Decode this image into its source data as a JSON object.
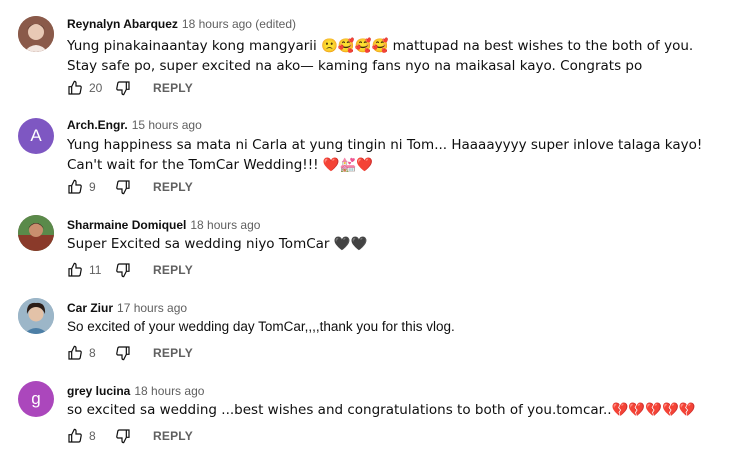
{
  "reply_label": "REPLY",
  "comments": [
    {
      "author": "Reynalyn Abarquez",
      "time": "18 hours ago (edited)",
      "text": "Yung pinakainaantay kong mangyarii 🙁🥰🥰🥰 mattupad na best wishes to the both of you. Stay safe po, super excited na ako— kaming fans nyo na maikasal kayo. Congrats po",
      "likes": "20",
      "avatar": {
        "type": "photo",
        "bg": "#8a5a4a",
        "fg": "#e8c9b5"
      }
    },
    {
      "author": "Arch.Engr.",
      "time": "15 hours ago",
      "text": "Yung happiness sa mata ni Carla at yung tingin ni Tom... Haaaayyyy super inlove talaga kayo! Can't wait for the TomCar Wedding!!! ❤️💒❤️",
      "likes": "9",
      "avatar": {
        "type": "letter",
        "letter": "A",
        "bg": "#7e57c2"
      }
    },
    {
      "author": "Sharmaine Domiquel",
      "time": "18 hours ago",
      "text": "Super Excited sa wedding niyo TomCar 🖤🖤",
      "likes": "11",
      "avatar": {
        "type": "photo",
        "bg": "#6b4a3a",
        "fg": "#c98e6e"
      }
    },
    {
      "author": "Car Ziur",
      "time": "17 hours ago",
      "text": "So excited of your wedding day TomCar,,,,thank you for this vlog.",
      "likes": "8",
      "avatar": {
        "type": "photo",
        "bg": "#7da0b8",
        "fg": "#e3c2a8"
      }
    },
    {
      "author": "grey lucina",
      "time": "18 hours ago",
      "text": "so excited sa wedding ...best wishes and congratulations to both of you.tomcar..💔💔💔💔💔",
      "likes": "8",
      "avatar": {
        "type": "letter",
        "letter": "g",
        "bg": "#ab47bc"
      }
    }
  ]
}
